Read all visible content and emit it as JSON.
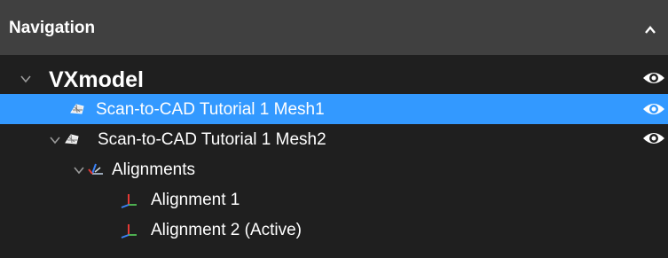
{
  "panel": {
    "title": "Navigation"
  },
  "tree": {
    "root": {
      "label": "VXmodel"
    },
    "mesh1": {
      "label": "Scan-to-CAD Tutorial 1 Mesh1"
    },
    "mesh2": {
      "label": "Scan-to-CAD Tutorial 1 Mesh2"
    },
    "alignments": {
      "label": "Alignments"
    },
    "alignment1": {
      "label": "Alignment 1"
    },
    "alignment2": {
      "label": "Alignment 2 (Active)"
    }
  },
  "icons": {
    "collapse": "chevron-up-icon",
    "expand": "chevron-down-icon",
    "visibility": "eye-icon",
    "mesh": "mesh-icon",
    "alignments": "alignments-icon",
    "alignment": "axis-icon"
  },
  "colors": {
    "header_bg": "#404040",
    "selected_row": "#3399ff",
    "tree_bg": "#1f1f1f",
    "text": "#ffffff"
  }
}
